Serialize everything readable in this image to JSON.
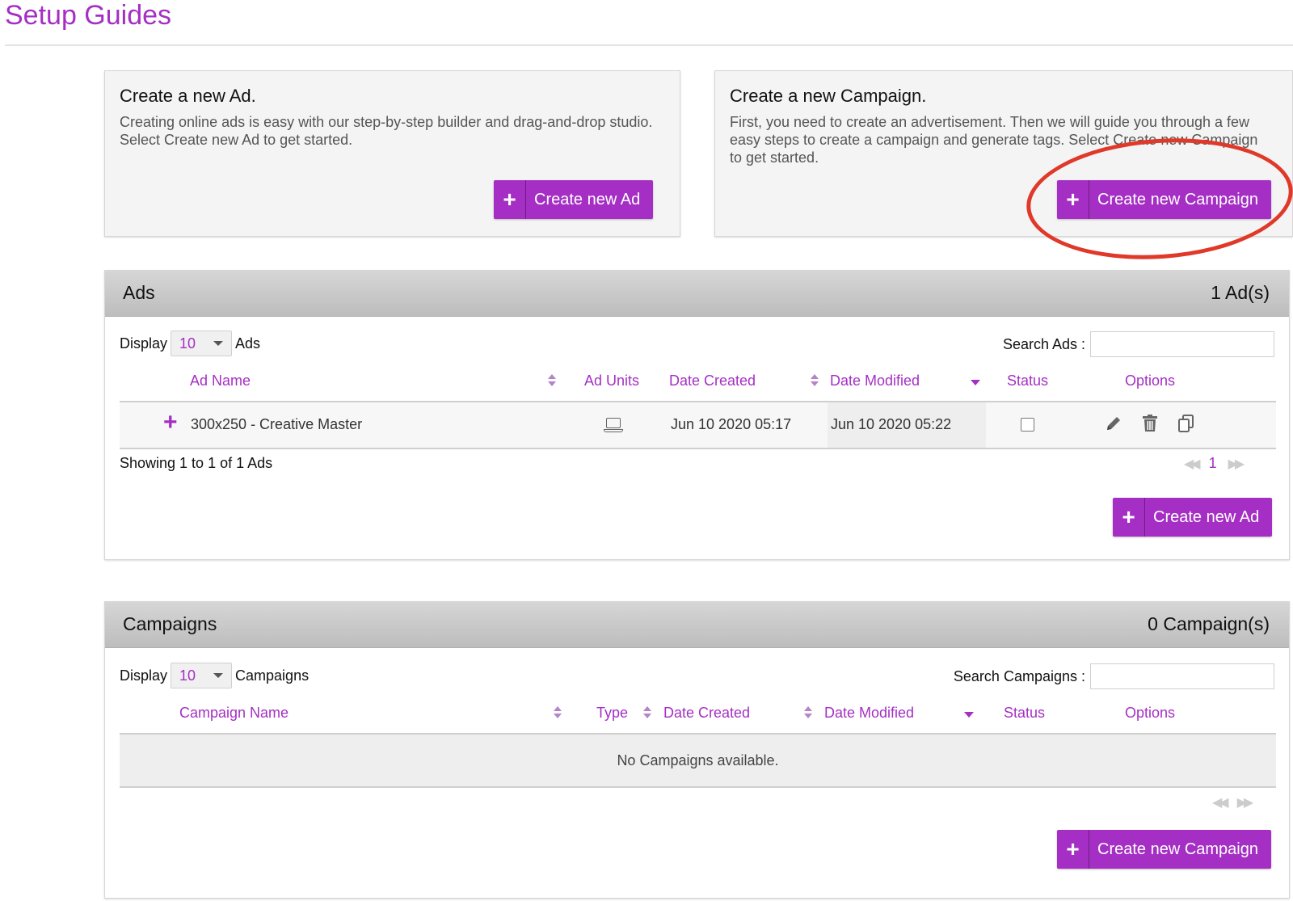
{
  "page": {
    "title": "Setup Guides"
  },
  "guides": {
    "ad": {
      "title": "Create a new Ad.",
      "description": "Creating online ads is easy with our step-by-step builder and drag-and-drop studio. Select Create new Ad to get started.",
      "button_label": "Create new Ad"
    },
    "campaign": {
      "title": "Create a new Campaign.",
      "description": "First, you need to create an advertisement. Then we will guide you through a few easy steps to create a campaign and generate tags. Select Create new Campaign to get started.",
      "button_label": "Create new Campaign"
    }
  },
  "ads_panel": {
    "title": "Ads",
    "count": "1 Ad(s)",
    "display_label": "Display",
    "display_value": "10",
    "display_suffix": "Ads",
    "search_label": "Search Ads :",
    "search_value": "",
    "columns": [
      "Ad Name",
      "Ad Units",
      "Date Created",
      "Date Modified",
      "Status",
      "Options"
    ],
    "rows": [
      {
        "name": "300x250 - Creative Master",
        "ad_unit_icon": "laptop-icon",
        "date_created": "Jun 10 2020 05:17",
        "date_modified": "Jun 10 2020 05:22",
        "status_checked": false
      }
    ],
    "option_icons": [
      "pencil-icon",
      "trash-icon",
      "copy-icon"
    ],
    "showing": "Showing 1 to 1 of 1 Ads",
    "current_page": "1",
    "button_label": "Create new Ad"
  },
  "campaigns_panel": {
    "title": "Campaigns",
    "count": "0 Campaign(s)",
    "display_label": "Display",
    "display_value": "10",
    "display_suffix": "Campaigns",
    "search_label": "Search Campaigns :",
    "search_value": "",
    "columns": [
      "Campaign Name",
      "Type",
      "Date Created",
      "Date Modified",
      "Status",
      "Options"
    ],
    "empty_message": "No Campaigns available.",
    "button_label": "Create new Campaign"
  },
  "colors": {
    "accent": "#a52fc4",
    "annotation": "#e0392a",
    "header_gray": "#c9c9c9"
  }
}
